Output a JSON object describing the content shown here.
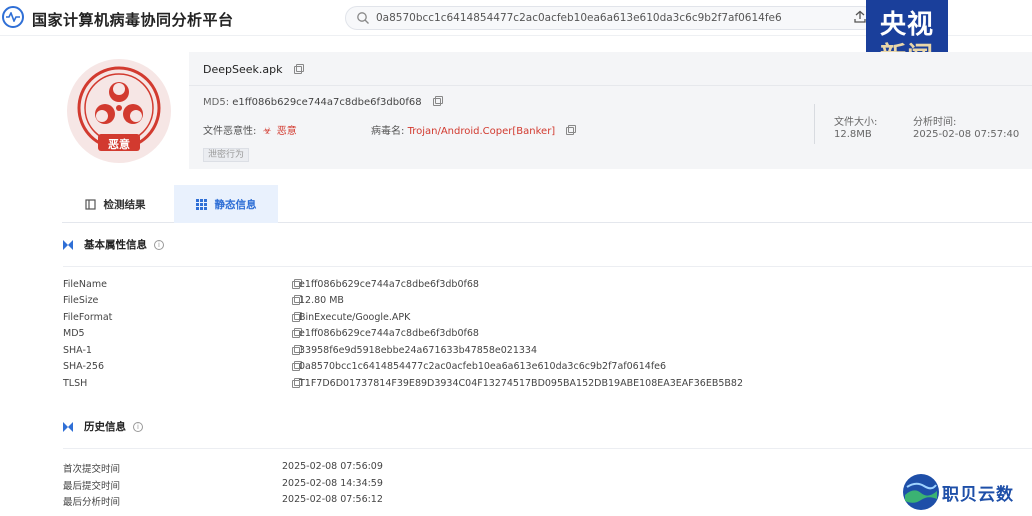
{
  "header": {
    "site_title": "国家计算机病毒协同分析平台",
    "search_value": "0a8570bcc1c6414854477c2ac0acfeb10ea6a613e610da3c6c9b2f7af0614fe6"
  },
  "watermark_top": {
    "line1": "央视",
    "line2": "新闻"
  },
  "badge": {
    "label": "恶意"
  },
  "summary": {
    "file_name": "DeepSeek.apk",
    "md5_label": "MD5:",
    "md5_value": "e1ff086b629ce744a7c8dbe6f3db0f68",
    "malice_label": "文件恶意性:",
    "malice_value": "恶意",
    "virus_label": "病毒名:",
    "virus_value": "Trojan/Android.Coper[Banker]",
    "tag": "泄密行为",
    "size_label": "文件大小:",
    "size_value": "12.8MB",
    "time_label": "分析时间:",
    "time_value": "2025-02-08 07:57:40"
  },
  "tabs": [
    {
      "label": "检测结果"
    },
    {
      "label": "静态信息"
    }
  ],
  "basic": {
    "title": "基本属性信息",
    "rows": [
      {
        "key": "FileName",
        "value": "e1ff086b629ce744a7c8dbe6f3db0f68"
      },
      {
        "key": "FileSize",
        "value": "12.80 MB"
      },
      {
        "key": "FileFormat",
        "value": "BinExecute/Google.APK"
      },
      {
        "key": "MD5",
        "value": "e1ff086b629ce744a7c8dbe6f3db0f68"
      },
      {
        "key": "SHA-1",
        "value": "33958f6e9d5918ebbe24a671633b47858e021334"
      },
      {
        "key": "SHA-256",
        "value": "0a8570bcc1c6414854477c2ac0acfeb10ea6a613e610da3c6c9b2f7af0614fe6"
      },
      {
        "key": "TLSH",
        "value": "T1F7D6D01737814F39E89D3934C04F13274517BD095BA152DB19ABE108EA3EAF36EB5B82"
      }
    ]
  },
  "history": {
    "title": "历史信息",
    "rows": [
      {
        "key": "首次提交时间",
        "value": "2025-02-08 07:56:09"
      },
      {
        "key": "最后提交时间",
        "value": "2025-02-08 14:34:59"
      },
      {
        "key": "最后分析时间",
        "value": "2025-02-08 07:56:12"
      }
    ]
  },
  "watermark_bottom": {
    "text": "职贝云数"
  },
  "colors": {
    "accent": "#2f6fd6",
    "danger": "#d23a2f",
    "cctv_blue": "#1a3f9b"
  }
}
